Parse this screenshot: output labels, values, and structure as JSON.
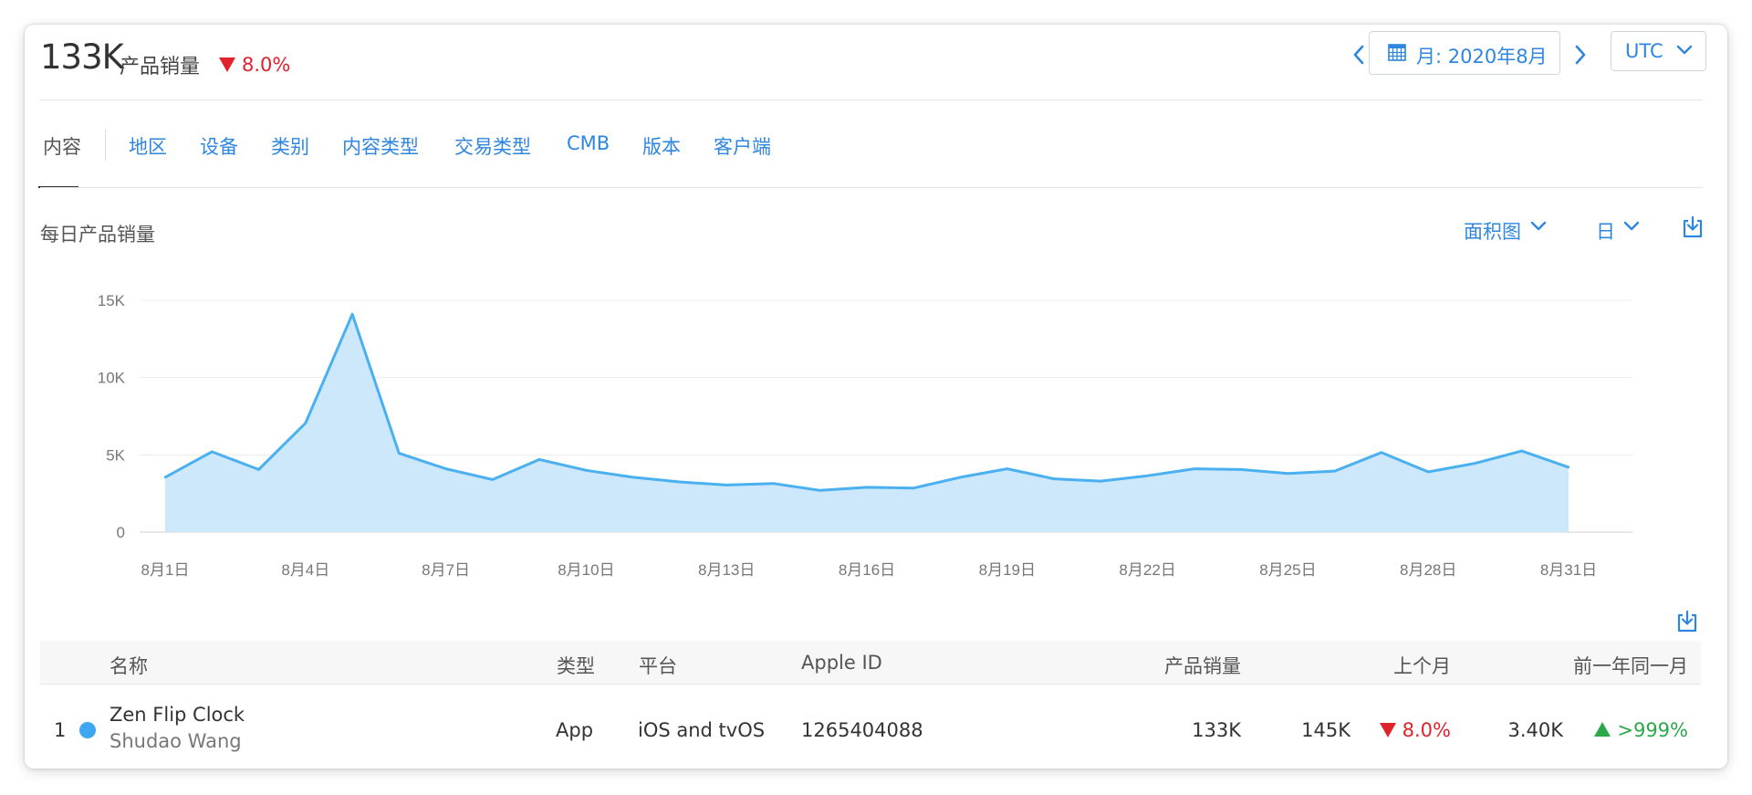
{
  "header": {
    "total_value": "133K",
    "total_label": "产品销量",
    "total_change": "8.0%",
    "date_label": "月: 2020年8月",
    "timezone": "UTC"
  },
  "tabs": [
    {
      "label": "内容",
      "active": true
    },
    {
      "label": "地区"
    },
    {
      "label": "设备"
    },
    {
      "label": "类别"
    },
    {
      "label": "内容类型"
    },
    {
      "label": "交易类型"
    },
    {
      "label": "CMB"
    },
    {
      "label": "版本"
    },
    {
      "label": "客户端"
    }
  ],
  "chart_section": {
    "title": "每日产品销量",
    "chart_type_label": "面积图",
    "period_label": "日"
  },
  "colors": {
    "accent": "#2f86df",
    "series_line": "#4ab0f0",
    "series_fill": "#cde7fb",
    "negative": "#e0222c",
    "positive": "#2aa84a"
  },
  "chart_data": {
    "type": "area",
    "title": "",
    "xlabel": "",
    "ylabel": "",
    "ylim": [
      0,
      15000
    ],
    "yticks": [
      0,
      5000,
      10000,
      15000
    ],
    "ytick_labels": [
      "0",
      "5K",
      "10K",
      "15K"
    ],
    "xtick_labels": [
      "8月1日",
      "8月4日",
      "8月7日",
      "8月10日",
      "8月13日",
      "8月16日",
      "8月19日",
      "8月22日",
      "8月25日",
      "8月28日",
      "8月31日"
    ],
    "xtick_days": [
      1,
      4,
      7,
      10,
      13,
      16,
      19,
      22,
      25,
      28,
      31
    ],
    "grid": true,
    "legend": false,
    "x": [
      1,
      2,
      3,
      4,
      5,
      6,
      7,
      8,
      9,
      10,
      11,
      12,
      13,
      14,
      15,
      16,
      17,
      18,
      19,
      20,
      21,
      22,
      23,
      24,
      25,
      26,
      27,
      28,
      29,
      30,
      31
    ],
    "series": [
      {
        "values": [
          3550,
          5200,
          4050,
          7050,
          14100,
          5100,
          4100,
          3400,
          4700,
          4000,
          3550,
          3250,
          3050,
          3150,
          2700,
          2900,
          2850,
          3550,
          4100,
          3450,
          3300,
          3650,
          4100,
          4050,
          3800,
          3950,
          5150,
          3900,
          4450,
          5250,
          4200
        ]
      }
    ]
  },
  "table": {
    "headers": {
      "name": "名称",
      "type": "类型",
      "platform": "平台",
      "apple_id": "Apple ID",
      "sales": "产品销量",
      "last_month": "上个月",
      "last_year": "前一年同一月"
    },
    "rows": [
      {
        "rank": "1",
        "title": "Zen Flip Clock",
        "developer": "Shudao Wang",
        "type": "App",
        "platform": "iOS and tvOS",
        "apple_id": "1265404088",
        "sales": "133K",
        "last_month_value": "145K",
        "last_month_change": "8.0%",
        "last_year_value": "3.40K",
        "last_year_change": ">999%"
      }
    ]
  }
}
